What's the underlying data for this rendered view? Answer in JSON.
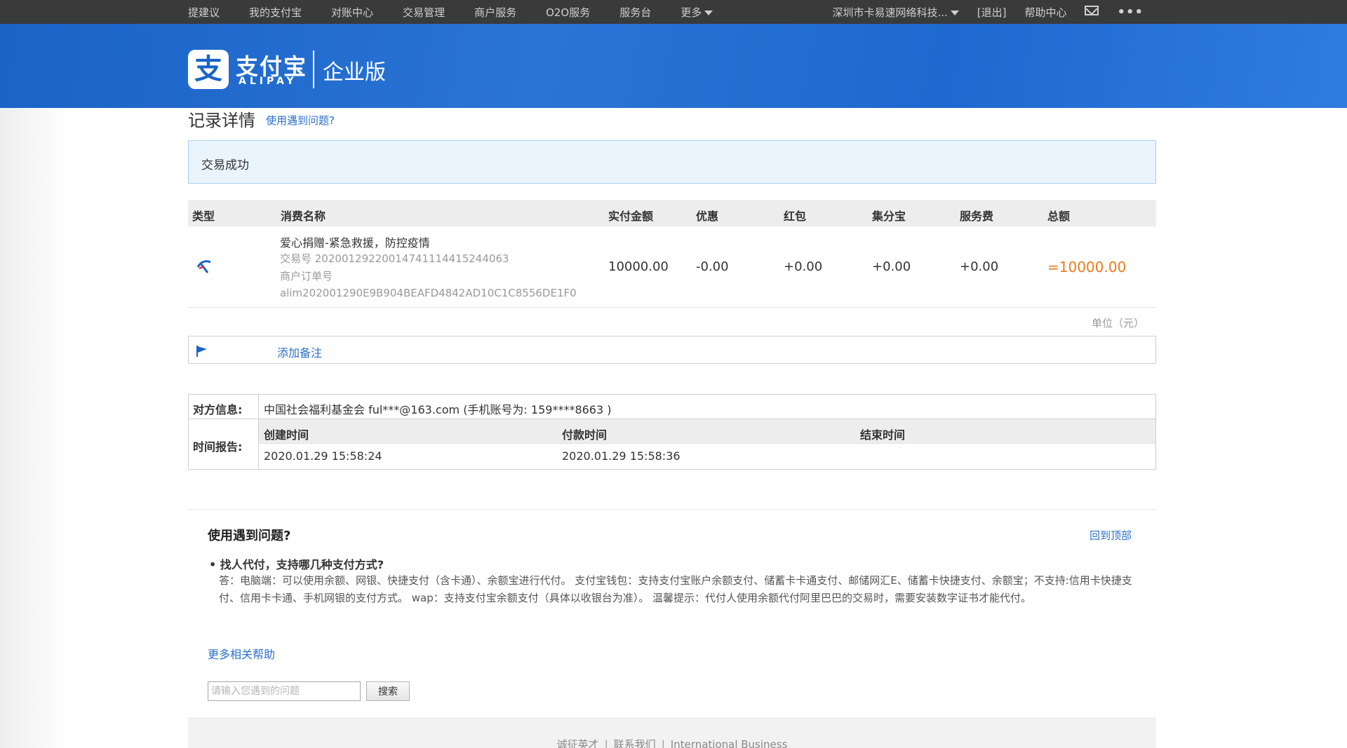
{
  "topbar": {
    "left": [
      "提建议",
      "我的支付宝",
      "对账中心",
      "交易管理",
      "商户服务",
      "O2O服务",
      "服务台",
      "更多"
    ],
    "account": "深圳市卡易速网络科技...",
    "logout": "[退出]",
    "help": "帮助中心",
    "icons": [
      "mail-icon",
      "more-dots-icon"
    ]
  },
  "header": {
    "logo_main": "支付宝",
    "logo_sub": "ALIPAY",
    "edition": "企业版",
    "brand_color": "#1b63c6"
  },
  "page": {
    "title": "记录详情",
    "title_link": "使用遇到问题?"
  },
  "status": {
    "text": "交易成功"
  },
  "table": {
    "headers": [
      "类型",
      "消费名称",
      "实付金额",
      "优惠",
      "红包",
      "集分宝",
      "服务费",
      "总额"
    ],
    "row": {
      "type_icon": "alipay-type-icon",
      "name": "爱心捐赠-紧急救援，防控疫情",
      "trade_no": "交易号 20200129220014741114415244063",
      "merchant_order_label": "商户订单号",
      "merchant_order_no": "alim202001290E9B904BEAFD4842AD10C1C8556DE1F0",
      "paid": "10000.00",
      "discount": "-0.00",
      "red_packet": "+0.00",
      "points": "+0.00",
      "service_fee": "+0.00",
      "total": "=10000.00"
    },
    "unit": "单位（元）"
  },
  "remark": {
    "link": "添加备注",
    "icon": "flag-icon"
  },
  "info": {
    "party_label": "对方信息:",
    "party_value": "中国社会福利基金会 ful***@163.com (手机账号为: 159****8663 )",
    "time_label": "时间报告:",
    "time_headers": [
      "创建时间",
      "付款时间",
      "结束时间"
    ],
    "time_values": [
      "2020.01.29 15:58:24",
      "2020.01.29 15:58:36",
      ""
    ]
  },
  "help": {
    "title": "使用遇到问题?",
    "back_top": "回到顶部",
    "question": "• 找人代付，支持哪几种支付方式?",
    "answer": "答：电脑端：可以使用余额、网银、快捷支付（含卡通）、余额宝进行代付。 支付宝钱包：支持支付宝账户余额支付、储蓄卡卡通支付、邮储网汇E、储蓄卡快捷支付、余额宝；不支持:信用卡快捷支付、信用卡卡通、手机网银的支付方式。 wap：支持支付宝余额支付（具体以收银台为准）。 温馨提示：代付人使用余额代付阿里巴巴的交易时，需要安装数字证书才能代付。",
    "more": "更多相关帮助",
    "search_placeholder": "请输入您遇到的问题",
    "search_button": "搜索"
  },
  "footer": {
    "links": [
      "诚征英才",
      "联系我们",
      "International Business"
    ]
  }
}
